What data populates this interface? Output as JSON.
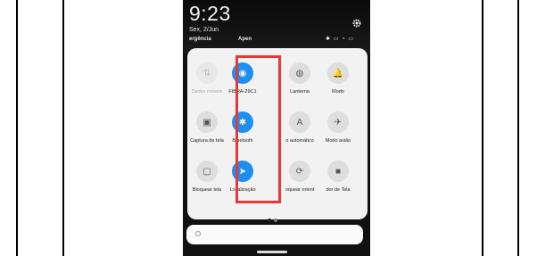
{
  "status": {
    "time": "9:23",
    "date": "Sex, 2/Jun",
    "carrier_left": "ergência",
    "carrier_right": "Apen"
  },
  "tiles": [
    {
      "label": "Dados móveis",
      "icon": "mobile-data-icon",
      "glyph": "⇅",
      "state": "disabled"
    },
    {
      "label": "FIBRA-29C1",
      "icon": "wifi-icon",
      "glyph": "◉",
      "state": "on"
    },
    {
      "label": "Lanterna",
      "icon": "flashlight-icon",
      "glyph": "◍",
      "state": "off"
    },
    {
      "label": "Modo",
      "icon": "bell-icon",
      "glyph": "🔔",
      "state": "off"
    },
    {
      "label": "Captura de tela",
      "icon": "screenshot-icon",
      "glyph": "▣",
      "state": "off"
    },
    {
      "label": "Bluetooth",
      "icon": "bluetooth-icon",
      "glyph": "✱",
      "state": "on"
    },
    {
      "label": "o automático",
      "icon": "auto-brightness-icon",
      "glyph": "A",
      "state": "off"
    },
    {
      "label": "Modo avião",
      "icon": "airplane-icon",
      "glyph": "✈",
      "state": "off"
    },
    {
      "label": "Bloquear tela",
      "icon": "lock-icon",
      "glyph": "▢",
      "state": "off"
    },
    {
      "label": "Localização",
      "icon": "location-icon",
      "glyph": "➤",
      "state": "on"
    },
    {
      "label": "oquear orient",
      "icon": "rotation-lock-icon",
      "glyph": "⟳",
      "state": "off"
    },
    {
      "label": "dor de Tela",
      "icon": "screen-recorder-icon",
      "glyph": "■",
      "state": "off"
    }
  ]
}
